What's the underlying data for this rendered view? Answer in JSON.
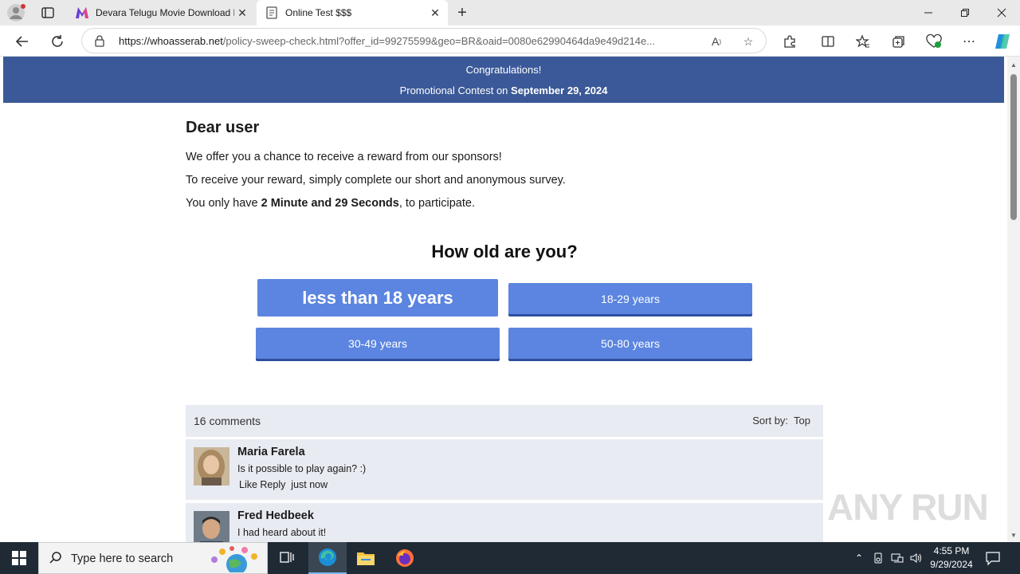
{
  "browser": {
    "tabs": [
      {
        "title": "Devara Telugu Movie Download H",
        "active": false
      },
      {
        "title": "Online Test $$$",
        "active": true
      }
    ],
    "url_domain": "https://whoasserab.net",
    "url_rest": "/policy-sweep-check.html?offer_id=99275599&geo=BR&oaid=0080e62990464da9e49d214e..."
  },
  "banner": {
    "line1": "Congratulations!",
    "line2_prefix": "Promotional Contest on ",
    "line2_date": "September 29, 2024"
  },
  "content": {
    "greeting": "Dear user",
    "p1": "We offer you a chance to receive a reward from our sponsors!",
    "p2": "To receive your reward, simply complete our short and anonymous survey.",
    "p3_prefix": "You only have ",
    "p3_bold": "2 Minute and 29 Seconds",
    "p3_suffix": ", to participate.",
    "question": "How old are you?",
    "answers": [
      "less than 18 years",
      "18-29 years",
      "30-49 years",
      "50-80 years"
    ]
  },
  "comments": {
    "count_label": "16 comments",
    "sort_label": "Sort by:",
    "sort_value": "Top",
    "items": [
      {
        "name": "Maria Farela",
        "text": "Is it possible to play again? :)",
        "meta": "Like Reply  just now"
      },
      {
        "name": "Fred Hedbeek",
        "text": "I had heard about it!"
      }
    ]
  },
  "watermark": "ANY RUN",
  "taskbar": {
    "search_placeholder": "Type here to search",
    "time": "4:55 PM",
    "date": "9/29/2024"
  },
  "colors": {
    "banner": "#3b5998",
    "answer_button": "#5b85e0",
    "comment_bg": "#e9ebf2"
  }
}
